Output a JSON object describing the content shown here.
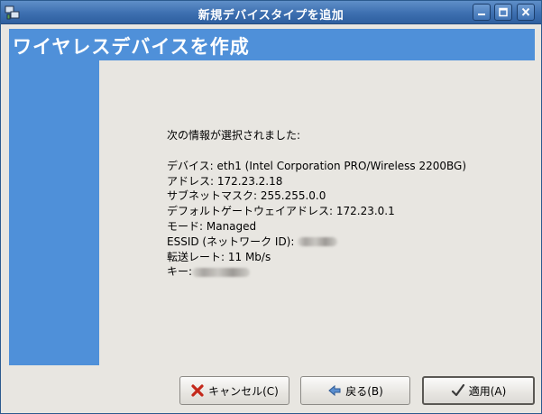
{
  "window": {
    "title": "新規デバイスタイプを追加"
  },
  "banner": {
    "title": "ワイヤレスデバイスを作成"
  },
  "info": {
    "heading": "次の情報が選択されました:",
    "device": "デバイス: eth1 (Intel Corporation PRO/Wireless 2200BG)",
    "address": "アドレス: 172.23.2.18",
    "subnet": "サブネットマスク: 255.255.0.0",
    "gateway": "デフォルトゲートウェイアドレス: 172.23.0.1",
    "mode": "モード: Managed",
    "essid_label": "ESSID (ネットワーク  ID): ",
    "rate": "転送レート: 11 Mb/s",
    "key_label": "キー:"
  },
  "buttons": {
    "cancel": "キャンセル(C)",
    "back": "戻る(B)",
    "apply": "適用(A)"
  },
  "colors": {
    "accent": "#4f90d9",
    "titlebar": "#3d6fb0",
    "background": "#e8e6e1"
  },
  "icons": {
    "app": "network-config-icon",
    "minimize": "minimize-icon",
    "maximize": "maximize-icon",
    "close": "close-icon",
    "cancel": "cancel-x-icon",
    "back": "arrow-left-icon",
    "apply": "checkmark-icon"
  }
}
